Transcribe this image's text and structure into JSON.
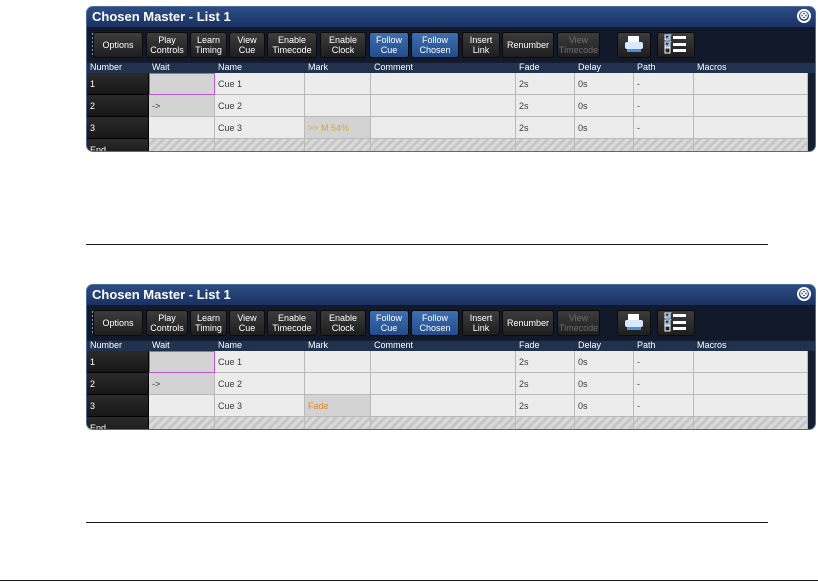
{
  "panels": [
    {
      "title": "Chosen Master - List 1",
      "close_icon": "⊗",
      "toolbar": [
        {
          "label": "Options",
          "state": "normal"
        },
        {
          "label": "Play\nControls",
          "state": "normal"
        },
        {
          "label": "Learn\nTiming",
          "state": "normal"
        },
        {
          "label": "View\nCue",
          "state": "normal"
        },
        {
          "label": "Enable\nTimecode",
          "state": "normal"
        },
        {
          "label": "Enable\nClock",
          "state": "normal"
        },
        {
          "label": "Follow\nCue",
          "state": "active"
        },
        {
          "label": "Follow\nChosen",
          "state": "active"
        },
        {
          "label": "Insert\nLink",
          "state": "normal"
        },
        {
          "label": "Renumber",
          "state": "normal"
        },
        {
          "label": "View\nTimecode",
          "state": "disabled"
        }
      ],
      "icons": [
        "print-icon",
        "checklist-icon"
      ],
      "columns": [
        "Number",
        "Wait",
        "Name",
        "Mark",
        "Comment",
        "Fade",
        "Delay",
        "Path",
        "Macros"
      ],
      "rows": [
        {
          "number": "1",
          "wait": "",
          "name": "Cue 1",
          "mark": "",
          "comment": "",
          "fade": "2s",
          "delay": "0s",
          "path": "-",
          "macros": ""
        },
        {
          "number": "2",
          "wait": "->",
          "name": "Cue 2",
          "mark": "",
          "comment": "",
          "fade": "2s",
          "delay": "0s",
          "path": "-",
          "macros": ""
        },
        {
          "number": "3",
          "wait": "",
          "name": "Cue 3",
          "mark": ">> M 54%",
          "comment": "",
          "fade": "2s",
          "delay": "0s",
          "path": "-",
          "macros": ""
        }
      ],
      "end_label": "End"
    },
    {
      "title": "Chosen Master - List 1",
      "close_icon": "⊗",
      "toolbar": [
        {
          "label": "Options",
          "state": "normal"
        },
        {
          "label": "Play\nControls",
          "state": "normal"
        },
        {
          "label": "Learn\nTiming",
          "state": "normal"
        },
        {
          "label": "View\nCue",
          "state": "normal"
        },
        {
          "label": "Enable\nTimecode",
          "state": "normal"
        },
        {
          "label": "Enable\nClock",
          "state": "normal"
        },
        {
          "label": "Follow\nCue",
          "state": "active"
        },
        {
          "label": "Follow\nChosen",
          "state": "active"
        },
        {
          "label": "Insert\nLink",
          "state": "normal"
        },
        {
          "label": "Renumber",
          "state": "normal"
        },
        {
          "label": "View\nTimecode",
          "state": "disabled"
        }
      ],
      "icons": [
        "print-icon",
        "checklist-icon"
      ],
      "columns": [
        "Number",
        "Wait",
        "Name",
        "Mark",
        "Comment",
        "Fade",
        "Delay",
        "Path",
        "Macros"
      ],
      "rows": [
        {
          "number": "1",
          "wait": "",
          "name": "Cue 1",
          "mark": "",
          "comment": "",
          "fade": "2s",
          "delay": "0s",
          "path": "-",
          "macros": ""
        },
        {
          "number": "2",
          "wait": "->",
          "name": "Cue 2",
          "mark": "",
          "comment": "",
          "fade": "2s",
          "delay": "0s",
          "path": "-",
          "macros": ""
        },
        {
          "number": "3",
          "wait": "",
          "name": "Cue 3",
          "mark": "Fade",
          "comment": "",
          "fade": "2s",
          "delay": "0s",
          "path": "-",
          "macros": ""
        }
      ],
      "end_label": "End"
    }
  ]
}
